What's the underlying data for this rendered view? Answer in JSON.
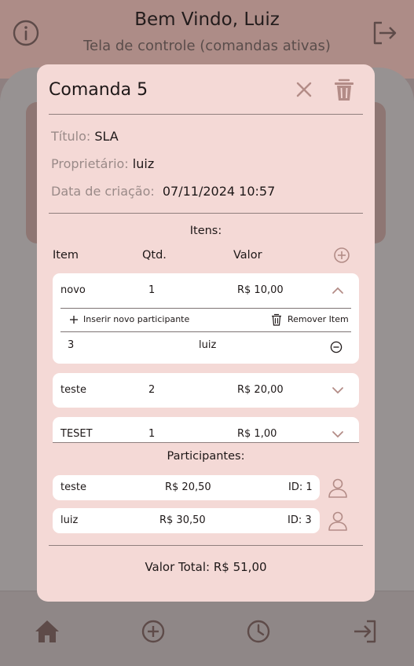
{
  "header": {
    "title": "Bem Vindo, Luiz",
    "subtitle": "Tela de controle (comandas ativas)"
  },
  "modal": {
    "title": "Comanda 5",
    "info": {
      "titulo_label": "Título:",
      "titulo_value": "SLA",
      "proprietario_label": "Proprietário:",
      "proprietario_value": "luiz",
      "data_label": "Data de criação:",
      "data_value": "07/11/2024 10:57"
    },
    "items_label": "Itens:",
    "columns": {
      "item": "Item",
      "qtd": "Qtd.",
      "valor": "Valor"
    },
    "items": [
      {
        "name": "novo",
        "qtd": "1",
        "valor": "R$ 10,00",
        "add_participant_label": "Inserir novo participante",
        "remove_item_label": "Remover Item",
        "participants": [
          {
            "id": "3",
            "name": "luiz"
          }
        ]
      },
      {
        "name": "teste",
        "qtd": "2",
        "valor": "R$ 20,00"
      },
      {
        "name": "TESET",
        "qtd": "1",
        "valor": "R$ 1,00"
      }
    ],
    "participants_label": "Participantes:",
    "participants": [
      {
        "name": "teste",
        "valor": "R$ 20,50",
        "id": "ID: 1"
      },
      {
        "name": "luiz",
        "valor": "R$ 30,50",
        "id": "ID: 3"
      }
    ],
    "total": "Valor Total: R$ 51,00"
  },
  "colors": {
    "modal_bg": "#f4d9d6",
    "accent": "#b38c87",
    "text": "#1e1818"
  },
  "icons": [
    "info-icon",
    "logout-icon",
    "close-icon",
    "trash-icon",
    "add-circle-icon",
    "chevron-up-icon",
    "chevron-down-icon",
    "plus-icon",
    "minus-circle-icon",
    "person-icon",
    "home-icon",
    "history-icon",
    "login-icon"
  ]
}
